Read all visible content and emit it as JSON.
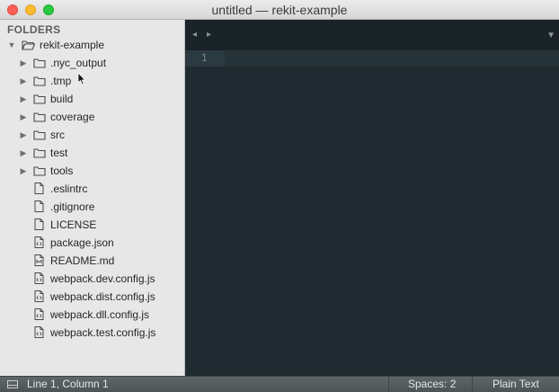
{
  "window": {
    "title": "untitled — rekit-example"
  },
  "sidebar": {
    "header": "FOLDERS",
    "root": {
      "label": "rekit-example",
      "expanded": true
    },
    "folders": [
      {
        "label": ".nyc_output"
      },
      {
        "label": ".tmp"
      },
      {
        "label": "build"
      },
      {
        "label": "coverage"
      },
      {
        "label": "src"
      },
      {
        "label": "test"
      },
      {
        "label": "tools"
      }
    ],
    "files": [
      {
        "label": ".eslintrc",
        "icon": "file-icon"
      },
      {
        "label": ".gitignore",
        "icon": "file-icon"
      },
      {
        "label": "LICENSE",
        "icon": "file-icon"
      },
      {
        "label": "package.json",
        "icon": "code-file-icon"
      },
      {
        "label": "README.md",
        "icon": "markdown-file-icon"
      },
      {
        "label": "webpack.dev.config.js",
        "icon": "code-file-icon"
      },
      {
        "label": "webpack.dist.config.js",
        "icon": "code-file-icon"
      },
      {
        "label": "webpack.dll.config.js",
        "icon": "code-file-icon"
      },
      {
        "label": "webpack.test.config.js",
        "icon": "code-file-icon"
      }
    ]
  },
  "editor": {
    "nav_left": "◂",
    "nav_right": "▸",
    "tab_dropdown": "▼",
    "line_numbers": [
      "1"
    ]
  },
  "statusbar": {
    "cursor_position": "Line 1, Column 1",
    "indentation": "Spaces: 2",
    "syntax": "Plain Text"
  }
}
